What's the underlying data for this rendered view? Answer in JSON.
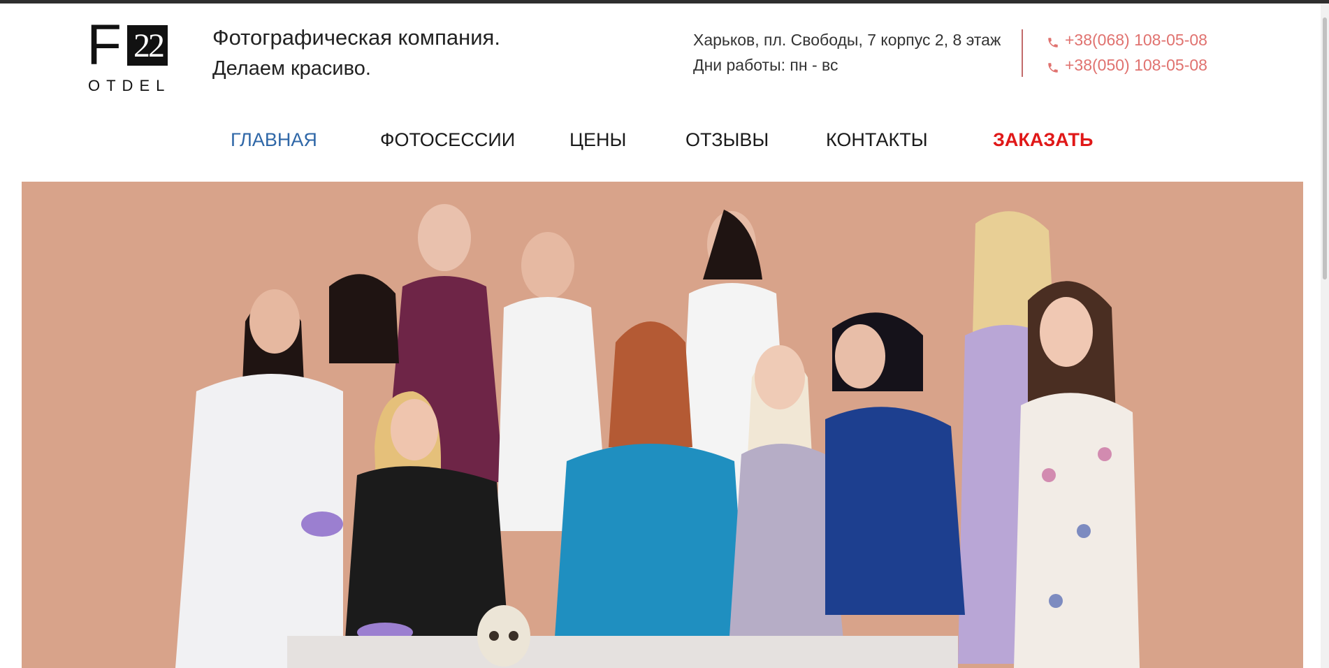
{
  "logo": {
    "letter": "F",
    "number": "22",
    "subtext": "OTDEL"
  },
  "tagline": {
    "line1": "Фотографическая компания.",
    "line2": "Делаем красиво."
  },
  "contact": {
    "address": "Харьков, пл. Свободы, 7 корпус 2, 8 этаж",
    "hours": "Дни работы: пн - вс",
    "phones": [
      "+38(068) 108-05-08",
      "+38(050) 108-05-08"
    ]
  },
  "nav": {
    "home": "ГЛАВНАЯ",
    "photoshoots": "ФОТОСЕССИИ",
    "prices": "ЦЕНЫ",
    "reviews": "ОТЗЫВЫ",
    "contacts": "КОНТАКТЫ",
    "order": "ЗАКАЗАТЬ"
  },
  "colors": {
    "active_nav": "#2f67a7",
    "order": "#e01818",
    "phone": "#e0726f",
    "hero_background": "#d8a38a"
  },
  "icons": [
    "phone-icon"
  ]
}
